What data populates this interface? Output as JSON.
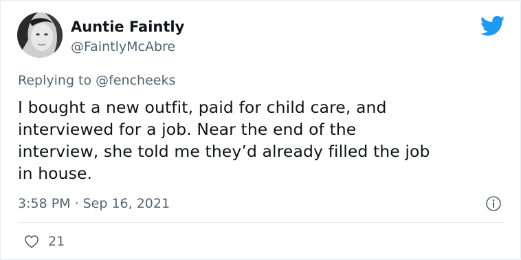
{
  "author": {
    "display_name": "Auntie Faintly",
    "handle": "@FaintlyMcAbre"
  },
  "reply": {
    "prefix": "Replying to ",
    "mention": "@fencheeks"
  },
  "tweet": {
    "lines": [
      "I bought a new outfit, paid for child care, and",
      "interviewed for a job. Near the end of the",
      "interview, she told me they’d already filled the job",
      "in house."
    ]
  },
  "meta": {
    "time": "3:58 PM",
    "separator": "·",
    "date": "Sep 16, 2021"
  },
  "engagement": {
    "likes": "21"
  },
  "icons": {
    "brand": "twitter-bird-icon",
    "info": "info-icon",
    "like": "heart-icon"
  },
  "colors": {
    "brand": "#1d9bf0",
    "text": "#0f1419",
    "secondary": "#536471",
    "border": "#e6ecf0"
  }
}
